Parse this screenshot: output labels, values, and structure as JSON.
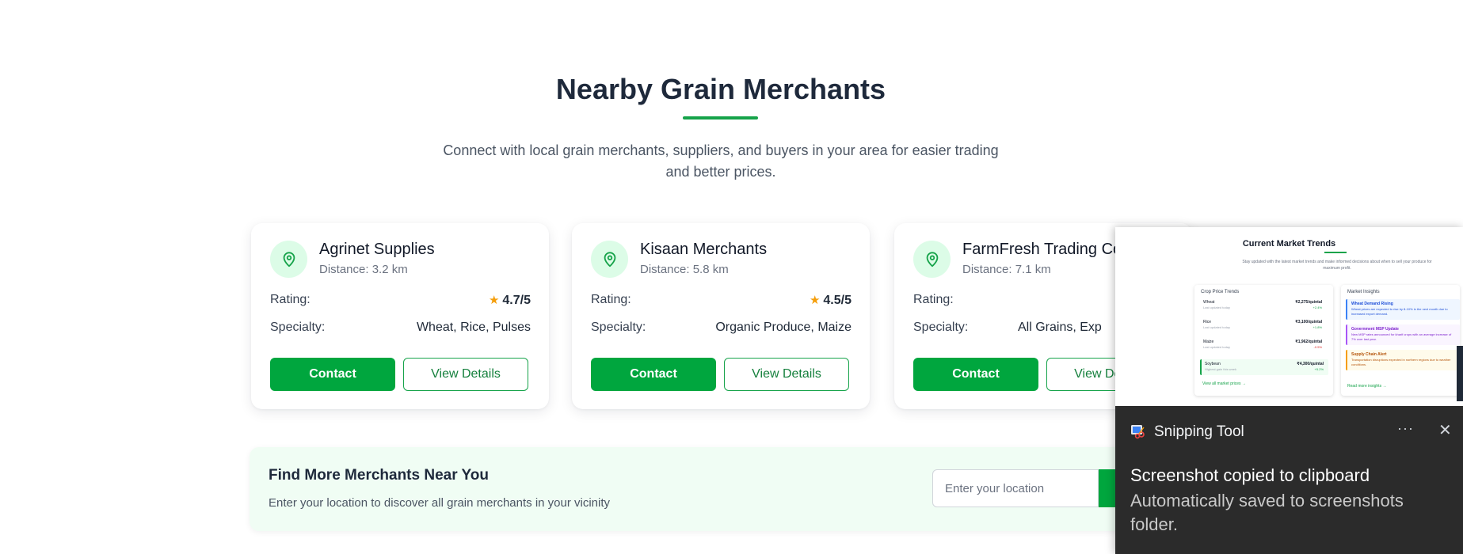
{
  "section": {
    "title": "Nearby Grain Merchants",
    "subtitle": "Connect with local grain merchants, suppliers, and buyers in your area for easier trading and better prices."
  },
  "labels": {
    "rating": "Rating:",
    "specialty": "Specialty:",
    "contact_button": "Contact",
    "details_button": "View Details"
  },
  "merchants": [
    {
      "name": "Agrinet Supplies",
      "distance": "Distance: 3.2 km",
      "rating": "4.7/5",
      "specialty": "Wheat, Rice, Pulses"
    },
    {
      "name": "Kisaan Merchants",
      "distance": "Distance: 5.8 km",
      "rating": "4.5/5",
      "specialty": "Organic Produce, Maize"
    },
    {
      "name": "FarmFresh Trading Co",
      "distance": "Distance: 7.1 km",
      "rating": "",
      "specialty": "All Grains, Exp"
    }
  ],
  "find": {
    "title": "Find More Merchants Near You",
    "description": "Enter your location to discover all grain merchants in your vicinity",
    "placeholder": "Enter your location"
  },
  "toast": {
    "app_name": "Snipping Tool",
    "more": "···",
    "close": "✕",
    "heading": "Screenshot copied to clipboard",
    "body": "Automatically saved to screenshots folder.",
    "preview": {
      "title": "Current Market Trends",
      "subtitle": "Stay updated with the latest market trends and make informed decisions about when to sell your produce for maximum profit.",
      "left_heading": "Crop Price Trends",
      "right_heading": "Market Insights",
      "crops": [
        {
          "name": "Wheat",
          "sub": "Last updated today",
          "price": "₹2,275/quintal",
          "change": "+2.4%"
        },
        {
          "name": "Rice",
          "sub": "Last updated today",
          "price": "₹3,100/quintal",
          "change": "+1.8%"
        },
        {
          "name": "Maize",
          "sub": "Last updated today",
          "price": "₹1,962/quintal",
          "change": "-0.5%"
        },
        {
          "name": "Soybean",
          "sub": "Highest gain this week",
          "price": "₹4,300/quintal",
          "change": "+5.2%"
        }
      ],
      "view_all": "View all market prices →",
      "insights": [
        {
          "title": "Wheat Demand Rising",
          "text": "Wheat prices are expected to rise by 8-10% in the next month due to increased export demand."
        },
        {
          "title": "Government MSP Update",
          "text": "New MSP rates announced for kharif crops with an average increase of 7% over last year."
        },
        {
          "title": "Supply Chain Alert",
          "text": "Transportation disruptions expected in northern regions due to weather conditions."
        }
      ],
      "read_more": "Read more insights →"
    }
  },
  "colors": {
    "brand_green": "#00a63e",
    "accent_green": "#16a34a",
    "icon_bg": "#dcfce7",
    "star": "#f59e0b",
    "panel_bg": "#f0fdf4",
    "toast_bg": "#2b2b2b"
  },
  "icons": {
    "merchant": "map-pin-icon",
    "rating": "star-icon",
    "app": "snipping-tool-icon"
  }
}
